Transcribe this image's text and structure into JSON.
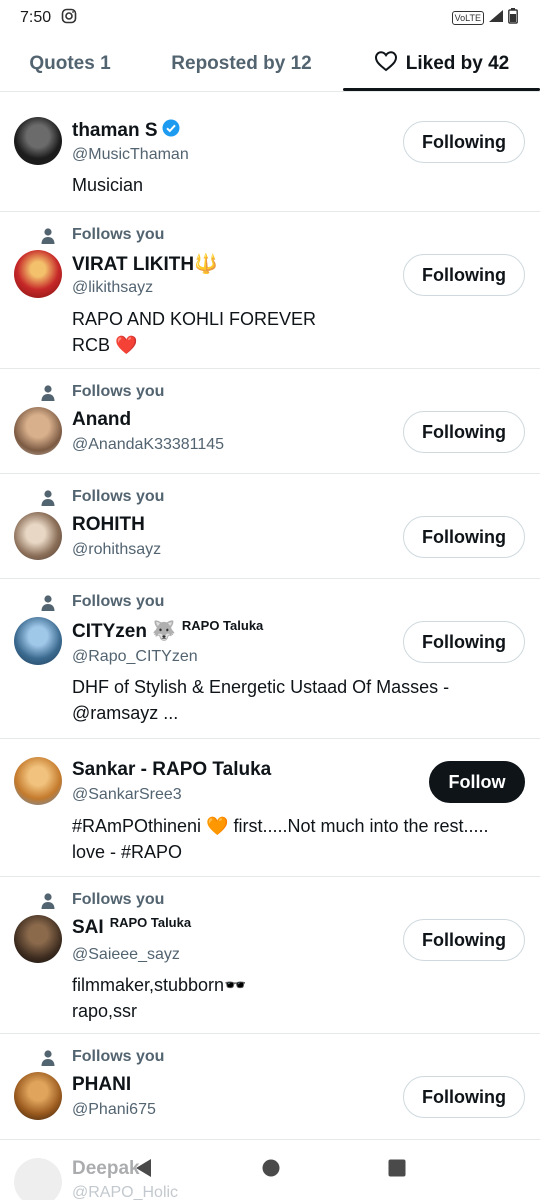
{
  "status": {
    "time": "7:50",
    "volte": "VoLTE",
    "network": "4G"
  },
  "tabs": [
    {
      "label": "Quotes 1"
    },
    {
      "label": "Reposted by 12"
    },
    {
      "label": "Liked by 42"
    }
  ],
  "users": [
    {
      "follows": "",
      "name": "thaman S",
      "sup": "",
      "verified": true,
      "handle": "@MusicThaman",
      "bio": [
        "Musician"
      ],
      "button": "Following"
    },
    {
      "follows": "Follows you",
      "name": "VIRAT LIKITH🔱",
      "sup": "",
      "verified": false,
      "handle": "@likithsayz",
      "bio": [
        "RAPO AND KOHLI FOREVER",
        "RCB ❤️"
      ],
      "button": "Following"
    },
    {
      "follows": "Follows you",
      "name": "Anand",
      "sup": "",
      "verified": false,
      "handle": "@AnandaK33381145",
      "bio": [],
      "button": "Following"
    },
    {
      "follows": "Follows you",
      "name": "ROHITH",
      "sup": "",
      "verified": false,
      "handle": "@rohithsayz",
      "bio": [],
      "button": "Following"
    },
    {
      "follows": "Follows you",
      "name": "CITYzen 🐺",
      "sup": "RAPO Taluka",
      "verified": false,
      "handle": "@Rapo_CITYzen",
      "bio": [
        "DHF of  Stylish & Energetic  Ustaad Of Masses -",
        "@ramsayz ..."
      ],
      "button": "Following"
    },
    {
      "follows": "",
      "name": "Sankar - RAPO Taluka",
      "sup": "",
      "verified": false,
      "handle": "@SankarSree3",
      "bio": [
        "#RAmPOthineni 🧡 first.....Not much into the rest.....",
        "love - #RAPO"
      ],
      "button": "Follow"
    },
    {
      "follows": "Follows you",
      "name": "SAI",
      "sup": "RAPO Taluka",
      "verified": false,
      "handle": "@Saieee_sayz",
      "bio": [
        "filmmaker,stubborn🕶️",
        "rapo,ssr"
      ],
      "button": "Following"
    },
    {
      "follows": "Follows you",
      "name": "PHANI",
      "sup": "",
      "verified": false,
      "handle": "@Phani675",
      "bio": [],
      "button": "Following"
    }
  ],
  "partial_user": {
    "name": "Deepak",
    "handle": "@RAPO_Holic"
  },
  "colors": {
    "text": "#0f1419",
    "muted": "#536471",
    "verified": "#1d9bf0",
    "border": "#e6e9ea"
  }
}
